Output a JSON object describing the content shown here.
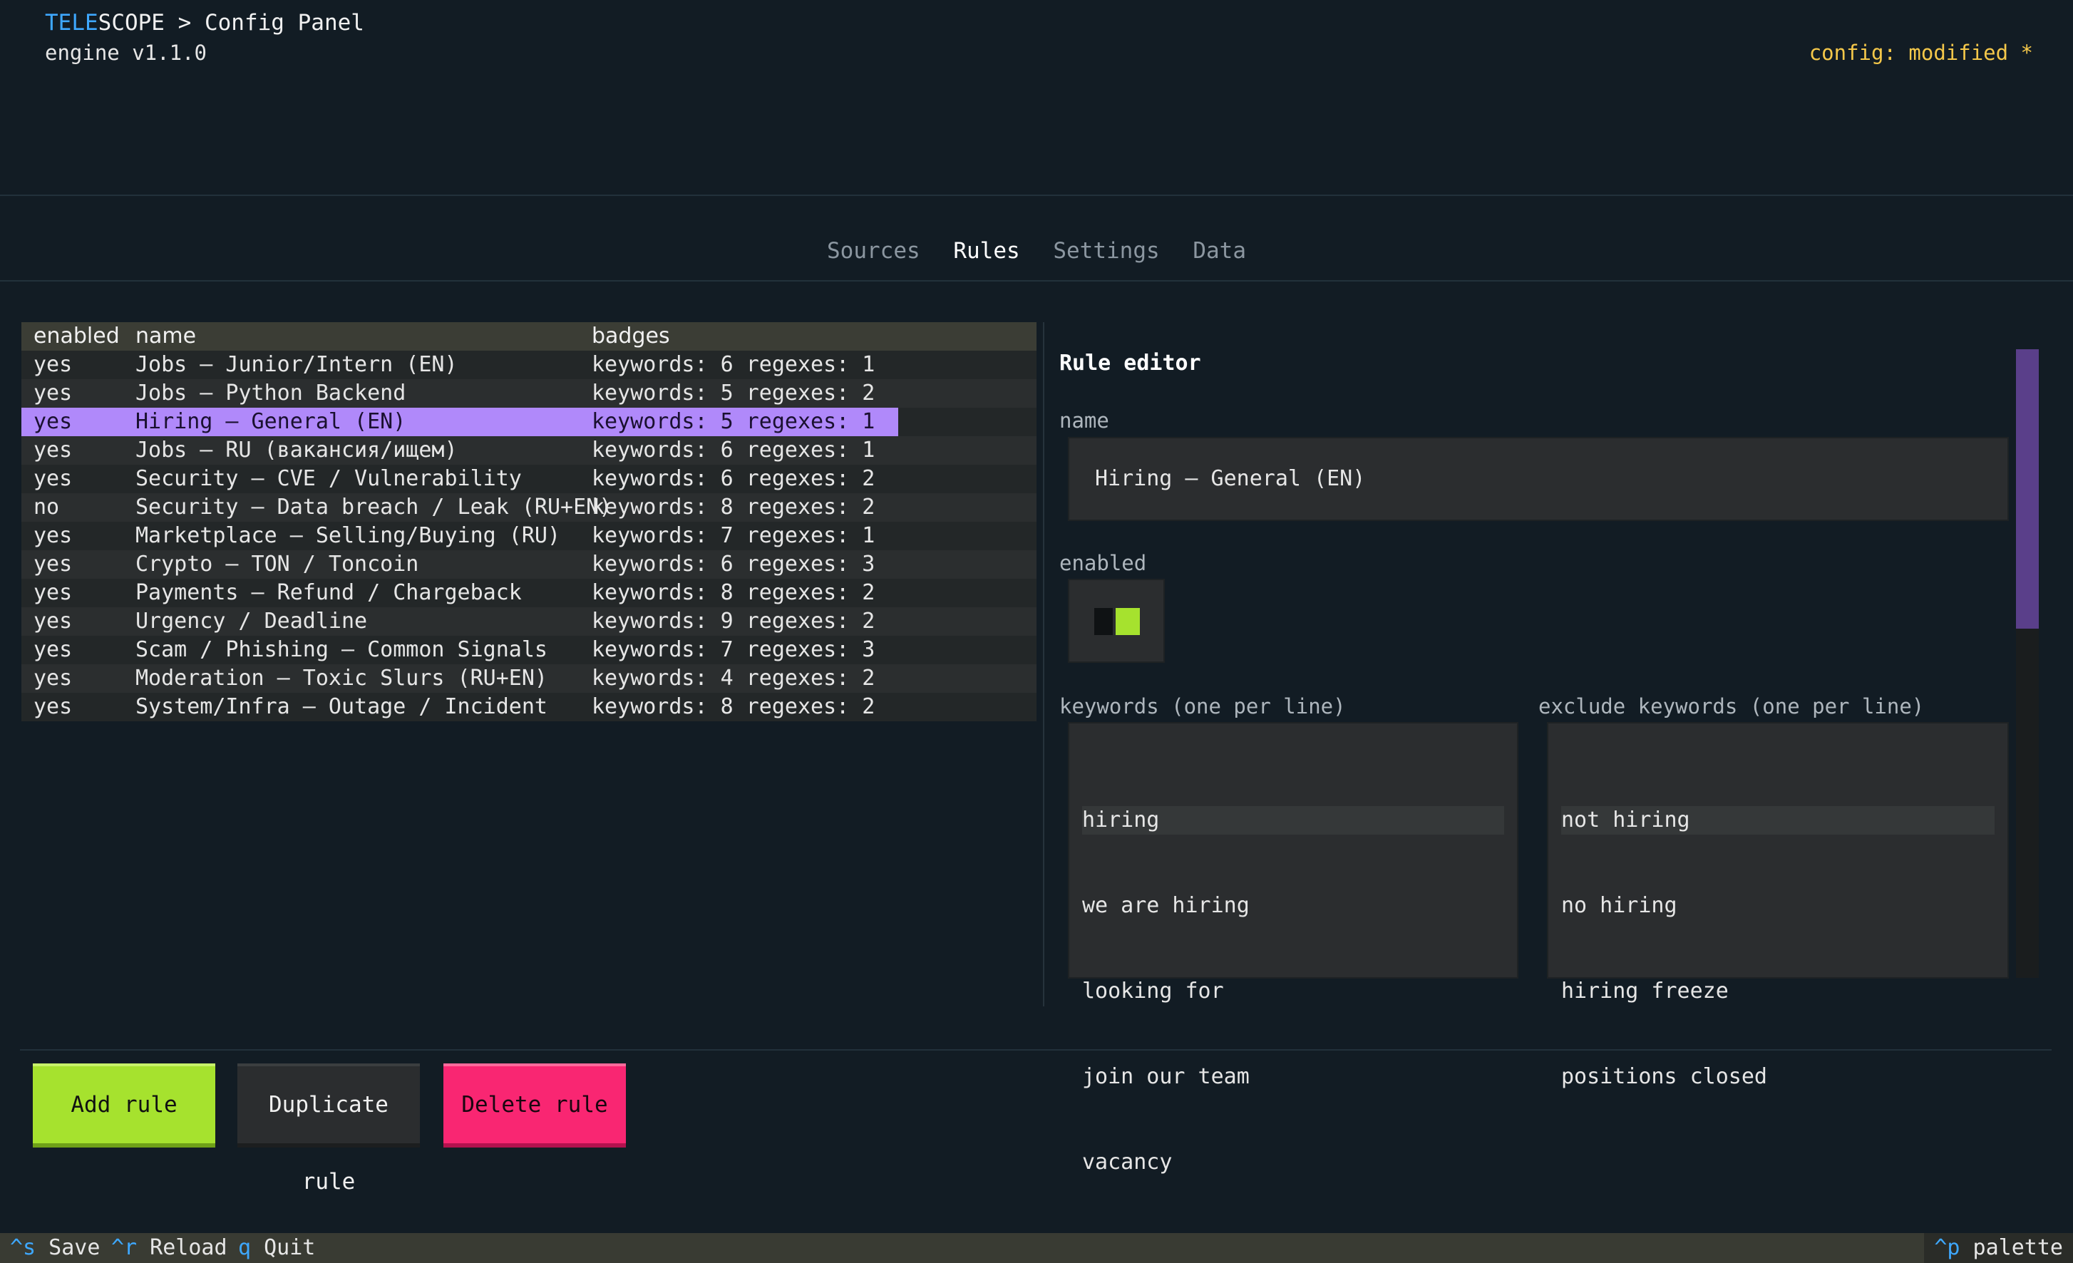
{
  "header": {
    "brand_part1": "TELE",
    "brand_part2": "SCOPE",
    "title_rest": " > Config Panel",
    "subtitle": "engine v1.1.0",
    "status": "config: modified *"
  },
  "tabs": [
    {
      "label": "Sources",
      "active": false
    },
    {
      "label": "Rules",
      "active": true
    },
    {
      "label": "Settings",
      "active": false
    },
    {
      "label": "Data",
      "active": false
    }
  ],
  "rules_table": {
    "columns": [
      "enabled",
      "name",
      "badges"
    ],
    "rows": [
      {
        "enabled": "yes",
        "name": "Jobs — Junior/Intern (EN)",
        "badges": "keywords: 6 regexes: 1"
      },
      {
        "enabled": "yes",
        "name": "Jobs — Python Backend",
        "badges": "keywords: 5 regexes: 2"
      },
      {
        "enabled": "yes",
        "name": "Hiring — General (EN)",
        "badges": "keywords: 5 regexes: 1"
      },
      {
        "enabled": "yes",
        "name": "Jobs — RU (вакансия/ищем)",
        "badges": "keywords: 6 regexes: 1"
      },
      {
        "enabled": "yes",
        "name": "Security — CVE / Vulnerability",
        "badges": "keywords: 6 regexes: 2"
      },
      {
        "enabled": "no",
        "name": "Security — Data breach / Leak (RU+EN)",
        "badges": "keywords: 8 regexes: 2"
      },
      {
        "enabled": "yes",
        "name": "Marketplace — Selling/Buying (RU)",
        "badges": "keywords: 7 regexes: 1"
      },
      {
        "enabled": "yes",
        "name": "Crypto — TON / Toncoin",
        "badges": "keywords: 6 regexes: 3"
      },
      {
        "enabled": "yes",
        "name": "Payments — Refund / Chargeback",
        "badges": "keywords: 8 regexes: 2"
      },
      {
        "enabled": "yes",
        "name": "Urgency / Deadline",
        "badges": "keywords: 9 regexes: 2"
      },
      {
        "enabled": "yes",
        "name": "Scam / Phishing — Common Signals",
        "badges": "keywords: 7 regexes: 3"
      },
      {
        "enabled": "yes",
        "name": "Moderation — Toxic Slurs (RU+EN)",
        "badges": "keywords: 4 regexes: 2"
      },
      {
        "enabled": "yes",
        "name": "System/Infra — Outage / Incident",
        "badges": "keywords: 8 regexes: 2"
      }
    ],
    "selected_index": 2
  },
  "editor": {
    "title": "Rule editor",
    "name_label": "name",
    "name_value": "Hiring — General (EN)",
    "enabled_label": "enabled",
    "enabled": true,
    "keywords_label": "keywords (one per line)",
    "keywords": [
      "hiring",
      "we are hiring",
      "looking for",
      "join our team",
      "vacancy"
    ],
    "exclude_label": "exclude keywords (one per line)",
    "exclude_keywords": [
      "not hiring",
      "no hiring",
      "hiring freeze",
      "positions closed"
    ]
  },
  "buttons": {
    "add": "Add rule",
    "duplicate": "Duplicate rule",
    "delete": "Delete rule"
  },
  "footer": {
    "save_key": "^s",
    "save_label": " Save",
    "reload_key": "^r",
    "reload_label": " Reload",
    "quit_key": "q",
    "quit_label": " Quit",
    "palette_key": "^p",
    "palette_label": " palette"
  },
  "colors": {
    "background": "#121c24",
    "accent_blue": "#3ea8ff",
    "selection": "#b089fa",
    "status_yellow": "#f5c84a",
    "add_green": "#a6e22e",
    "delete_pink": "#f92672"
  }
}
